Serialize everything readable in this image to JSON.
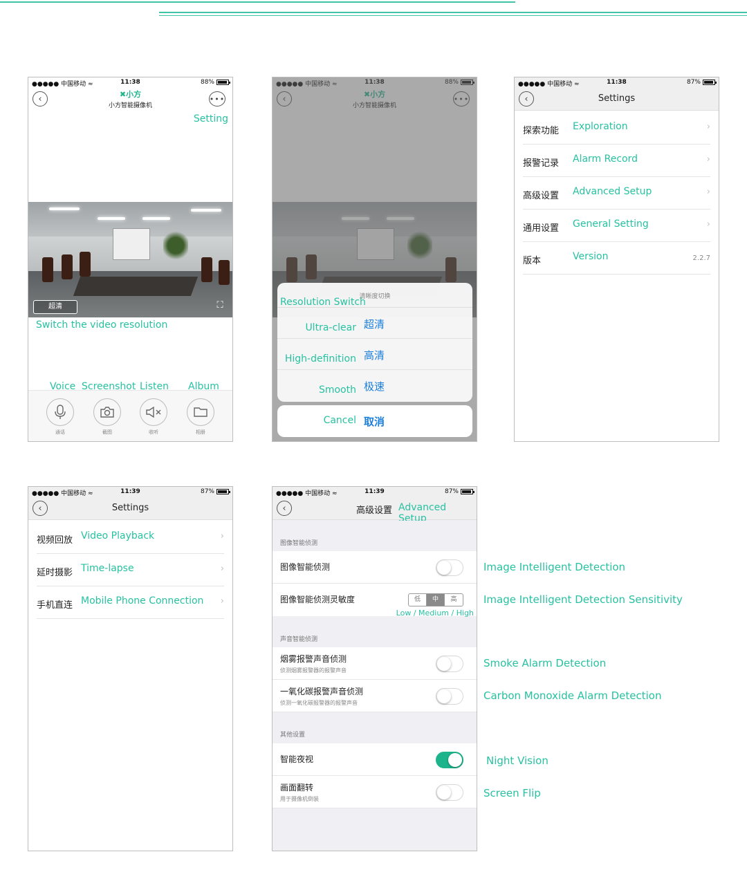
{
  "colors": {
    "accent": "#27c1a1",
    "toggle_on": "#1db48c",
    "link_blue": "#1c7fdb"
  },
  "status": {
    "carrier": "●●●●● 中国移动 ≈",
    "time_a": "11:38",
    "time_b": "11:39",
    "battery_88": "88%",
    "battery_87": "87%"
  },
  "screen1": {
    "logo": "✖小方",
    "subtitle": "小方智能摄像机",
    "anno_setting": "Setting",
    "resolution_chip": "超清",
    "anno_switch": "Switch the video resolution",
    "anno_voice": "Voice",
    "anno_screenshot": "Screenshot",
    "anno_listen": "Listen",
    "anno_album": "Album",
    "controls": [
      {
        "label": "通话",
        "icon": "microphone-icon"
      },
      {
        "label": "截图",
        "icon": "camera-icon"
      },
      {
        "label": "收听",
        "icon": "speaker-mute-icon"
      },
      {
        "label": "相册",
        "icon": "folder-icon"
      }
    ]
  },
  "screen2": {
    "sheet_title": "清晰度切换",
    "anno_title": "Resolution Switch",
    "options": [
      {
        "cn": "超清",
        "en": "Ultra-clear"
      },
      {
        "cn": "高清",
        "en": "High-definition"
      },
      {
        "cn": "极速",
        "en": "Smooth"
      }
    ],
    "cancel_cn": "取消",
    "cancel_en": "Cancel"
  },
  "screen3": {
    "title": "Settings",
    "rows": [
      {
        "cn": "探索功能",
        "en": "Exploration"
      },
      {
        "cn": "报警记录",
        "en": "Alarm Record"
      },
      {
        "cn": "高级设置",
        "en": "Advanced Setup"
      },
      {
        "cn": "通用设置",
        "en": "General Setting"
      },
      {
        "cn": "版本",
        "en": "Version",
        "value": "2.2.7"
      }
    ]
  },
  "screen4": {
    "title": "Settings",
    "rows": [
      {
        "cn": "视频回放",
        "en": "Video Playback"
      },
      {
        "cn": "延时摄影",
        "en": "Time-lapse"
      },
      {
        "cn": "手机直连",
        "en": "Mobile Phone Connection"
      }
    ]
  },
  "screen5": {
    "title_cn": "高级设置",
    "title_en": "Advanced Setup",
    "section_image": "图像智能侦测",
    "row_image_detect": "图像智能侦测",
    "row_image_sens": "图像智能侦测灵敏度",
    "seg_low": "低",
    "seg_mid": "中",
    "seg_high": "高",
    "anno_seg": "Low / Medium / High",
    "section_sound": "声音智能侦测",
    "row_smoke": "烟雾报警声音侦测",
    "row_smoke_sub": "侦测烟雾报警器的报警声音",
    "row_co": "一氧化碳报警声音侦测",
    "row_co_sub": "侦测一氧化碳报警器的报警声音",
    "section_other": "其他设置",
    "row_night": "智能夜视",
    "night_vision_on": true,
    "row_flip": "画面翻转",
    "row_flip_sub": "用于摄像机倒装"
  },
  "side_annotations": {
    "image_detection": "Image Intelligent Detection",
    "image_sensitivity": "Image Intelligent Detection Sensitivity",
    "smoke": "Smoke Alarm Detection",
    "co": "Carbon Monoxide Alarm Detection",
    "night": "Night Vision",
    "flip": "Screen Flip"
  }
}
